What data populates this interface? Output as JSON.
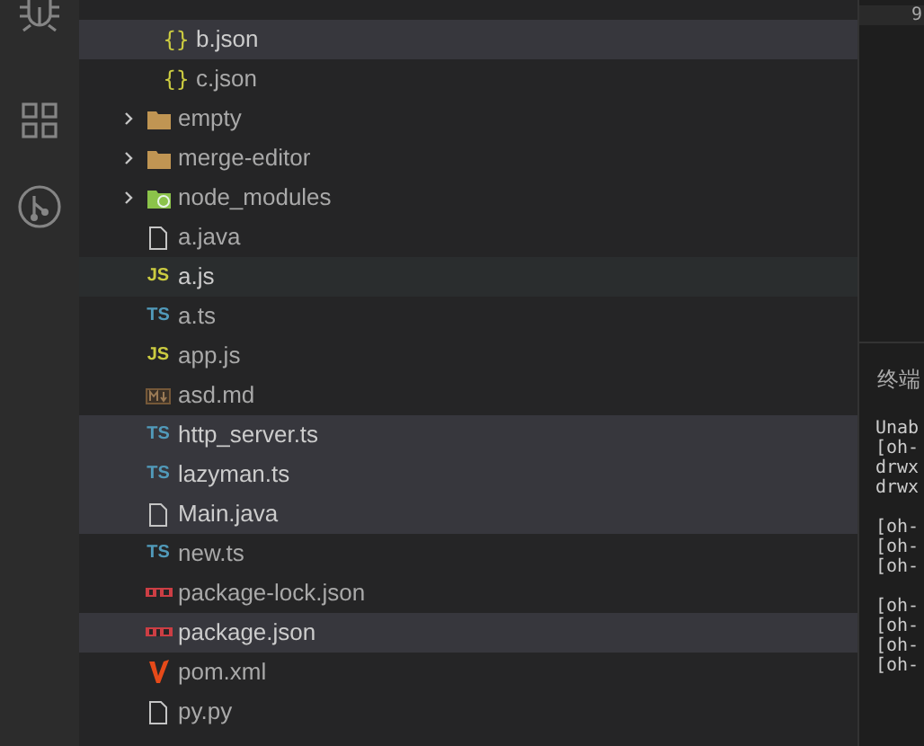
{
  "activity_bar": {
    "items": [
      {
        "kind": "debug",
        "selected": false
      },
      {
        "kind": "extensions",
        "selected": false
      },
      {
        "kind": "source-control",
        "selected": false
      }
    ]
  },
  "explorer": {
    "nested_items": [
      {
        "label": "b.json",
        "kind": "json",
        "icon_text": "{}",
        "selected": true,
        "hovered": false
      },
      {
        "label": "c.json",
        "kind": "json",
        "icon_text": "{}",
        "selected": false,
        "hovered": false
      }
    ],
    "items": [
      {
        "label": "empty",
        "kind": "folder",
        "expanded": false,
        "selected": false,
        "hovered": false
      },
      {
        "label": "merge-editor",
        "kind": "folder",
        "expanded": false,
        "selected": false,
        "hovered": false
      },
      {
        "label": "node_modules",
        "kind": "node-folder",
        "expanded": false,
        "selected": false,
        "hovered": false
      },
      {
        "label": "a.java",
        "kind": "file",
        "selected": false,
        "hovered": false
      },
      {
        "label": "a.js",
        "kind": "js",
        "icon_text": "JS",
        "selected": false,
        "hovered": true
      },
      {
        "label": "a.ts",
        "kind": "ts",
        "icon_text": "TS",
        "selected": false,
        "hovered": false
      },
      {
        "label": "app.js",
        "kind": "js",
        "icon_text": "JS",
        "selected": false,
        "hovered": false
      },
      {
        "label": "asd.md",
        "kind": "markdown",
        "selected": false,
        "hovered": false
      },
      {
        "label": "http_server.ts",
        "kind": "ts",
        "icon_text": "TS",
        "selected": true,
        "hovered": false
      },
      {
        "label": "lazyman.ts",
        "kind": "ts",
        "icon_text": "TS",
        "selected": true,
        "hovered": false
      },
      {
        "label": "Main.java",
        "kind": "file",
        "selected": true,
        "hovered": false
      },
      {
        "label": "new.ts",
        "kind": "ts",
        "icon_text": "TS",
        "selected": false,
        "hovered": false
      },
      {
        "label": "package-lock.json",
        "kind": "npm",
        "selected": false,
        "hovered": false
      },
      {
        "label": "package.json",
        "kind": "npm",
        "selected": true,
        "hovered": false
      },
      {
        "label": "pom.xml",
        "kind": "maven",
        "selected": false,
        "hovered": false
      },
      {
        "label": "py.py",
        "kind": "file",
        "selected": false,
        "hovered": false
      }
    ]
  },
  "editor": {
    "line_number": "9"
  },
  "panel": {
    "tab": "终端",
    "terminal_blocks": [
      [
        "Unab",
        "[oh-",
        "drwx",
        "drwx"
      ],
      [
        "[oh-",
        "[oh-",
        "[oh-"
      ],
      [
        "[oh-",
        "[oh-",
        "[oh-",
        "[oh-"
      ]
    ]
  }
}
